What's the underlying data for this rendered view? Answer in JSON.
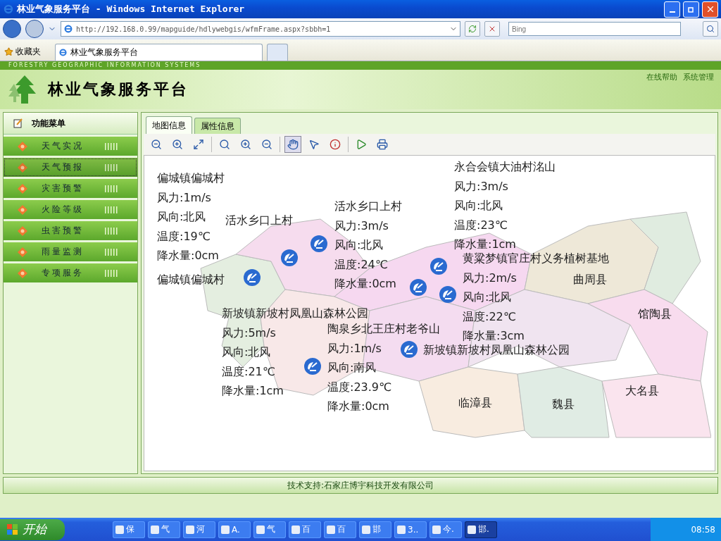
{
  "window": {
    "title": "林业气象服务平台 - Windows Internet Explorer"
  },
  "browser": {
    "address": "http://192.168.0.99/mapguide/hdlywebgis/wfmFrame.aspx?sbbh=1",
    "search_placeholder": "Bing",
    "favorites": "收藏夹",
    "tab_title": "林业气象服务平台"
  },
  "header": {
    "subtitle": "FORESTRY GEOGRAPHIC INFORMATION SYSTEMS",
    "title": "林业气象服务平台",
    "links": [
      "在线帮助",
      "系统管理"
    ]
  },
  "sidebar": {
    "heading": "功能菜单",
    "items": [
      {
        "label": "天气实况",
        "selected": false
      },
      {
        "label": "天气预报",
        "selected": true
      },
      {
        "label": "灾害预警",
        "selected": false
      },
      {
        "label": "火险等级",
        "selected": false
      },
      {
        "label": "虫害预警",
        "selected": false
      },
      {
        "label": "雨量监测",
        "selected": false
      },
      {
        "label": "专项服务",
        "selected": false
      }
    ]
  },
  "tabs": [
    {
      "label": "地图信息",
      "selected": true
    },
    {
      "label": "属性信息",
      "selected": false
    }
  ],
  "map": {
    "stations": [
      {
        "name": "偏城镇偏城村",
        "lines": [
          "风力:1m/s",
          "风向:北风",
          "温度:19℃",
          "降水量:0cm"
        ]
      },
      {
        "name": "活水乡口上村"
      },
      {
        "name": "活水乡口上村",
        "lines": [
          "风力:3m/s",
          "风向:北风",
          "温度:24℃",
          "降水量:0cm"
        ]
      },
      {
        "name": "永合会镇大油村洺山",
        "lines": [
          "风力:3m/s",
          "风向:北风",
          "温度:23℃",
          "降水量:1cm"
        ]
      },
      {
        "name": "黄粱梦镇官庄村义务植树基地",
        "lines": [
          "风力:2m/s",
          "风向:北风",
          "温度:22℃",
          "降水量:3cm"
        ]
      },
      {
        "name": "偏城镇偏城村"
      },
      {
        "name": "新坡镇新坡村凤凰山森林公园",
        "lines": [
          "风力:5m/s",
          "风向:北风",
          "温度:21℃",
          "降水量:1cm"
        ]
      },
      {
        "name": "陶泉乡北王庄村老爷山",
        "lines": [
          "风力:1m/s",
          "风向:南风",
          "温度:23.9℃",
          "降水量:0cm"
        ]
      },
      {
        "name": "新坡镇新坡村凤凰山森林公园"
      }
    ],
    "counties": [
      "曲周县",
      "馆陶县",
      "临漳县",
      "魏县",
      "大名县"
    ]
  },
  "footer": "技术支持:石家庄博宇科技开发有限公司",
  "taskbar": {
    "start": "开始",
    "tasks": [
      {
        "label": "保",
        "selected": false
      },
      {
        "label": "气",
        "selected": false
      },
      {
        "label": "河",
        "selected": false
      },
      {
        "label": "A.",
        "selected": false
      },
      {
        "label": "气",
        "selected": false
      },
      {
        "label": "百",
        "selected": false
      },
      {
        "label": "百",
        "selected": false
      },
      {
        "label": "邯",
        "selected": false
      },
      {
        "label": "3..",
        "selected": false
      },
      {
        "label": "今.",
        "selected": false
      },
      {
        "label": "邯.",
        "selected": true
      }
    ],
    "clock": "08:58"
  }
}
